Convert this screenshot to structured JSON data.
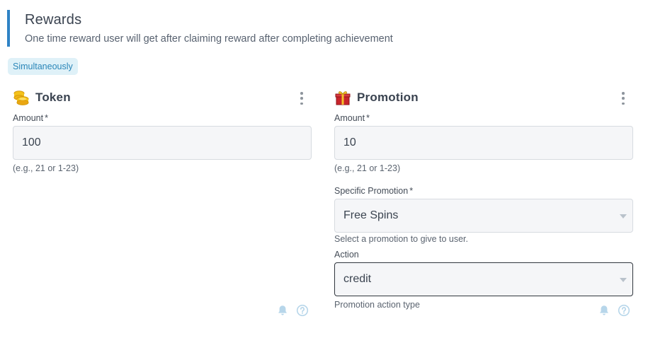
{
  "header": {
    "title": "Rewards",
    "subtitle": "One time reward user will get after claiming reward after completing achievement"
  },
  "mode_badge": "Simultaneously",
  "token": {
    "title": "Token",
    "icon": "coins-icon",
    "amount_label": "Amount",
    "required_mark": "*",
    "amount_value": "100",
    "amount_hint": "(e.g., 21 or 1-23)"
  },
  "promotion": {
    "title": "Promotion",
    "icon": "gift-icon",
    "amount_label": "Amount",
    "required_mark": "*",
    "amount_value": "10",
    "amount_hint": "(e.g., 21 or 1-23)",
    "specific_label": "Specific Promotion",
    "specific_value": "Free Spins",
    "specific_hint": "Select a promotion to give to user.",
    "action_label": "Action",
    "action_value": "credit",
    "action_hint": "Promotion action type"
  },
  "colors": {
    "accent": "#2f83c5",
    "badge_bg": "#dff1f8",
    "badge_text": "#2a86b8",
    "field_bg": "#f5f6f8",
    "footer_icon": "#b7d6ea"
  }
}
